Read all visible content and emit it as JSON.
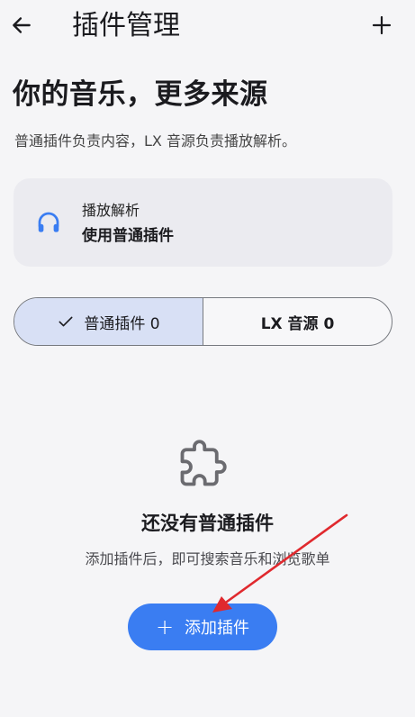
{
  "header": {
    "title": "插件管理",
    "back_icon": "arrow-left-icon",
    "add_icon": "plus-icon"
  },
  "hero": {
    "headline": "你的音乐，更多来源",
    "subtitle": "普通插件负责内容，LX 音源负责播放解析。"
  },
  "playback_card": {
    "icon": "headphones-icon",
    "label": "播放解析",
    "value": "使用普通插件"
  },
  "tabs": [
    {
      "label": "普通插件 0",
      "selected": true
    },
    {
      "label": "LX 音源 0",
      "selected": false
    }
  ],
  "empty_state": {
    "icon": "puzzle-icon",
    "title": "还没有普通插件",
    "description": "添加插件后，即可搜索音乐和浏览歌单"
  },
  "add_button": {
    "icon": "plus",
    "label": "添加插件"
  },
  "colors": {
    "accent": "#3a7df2",
    "selected_tab": "#d8e0f5",
    "card_bg": "#ebebf0",
    "annotation": "#e0292e"
  }
}
